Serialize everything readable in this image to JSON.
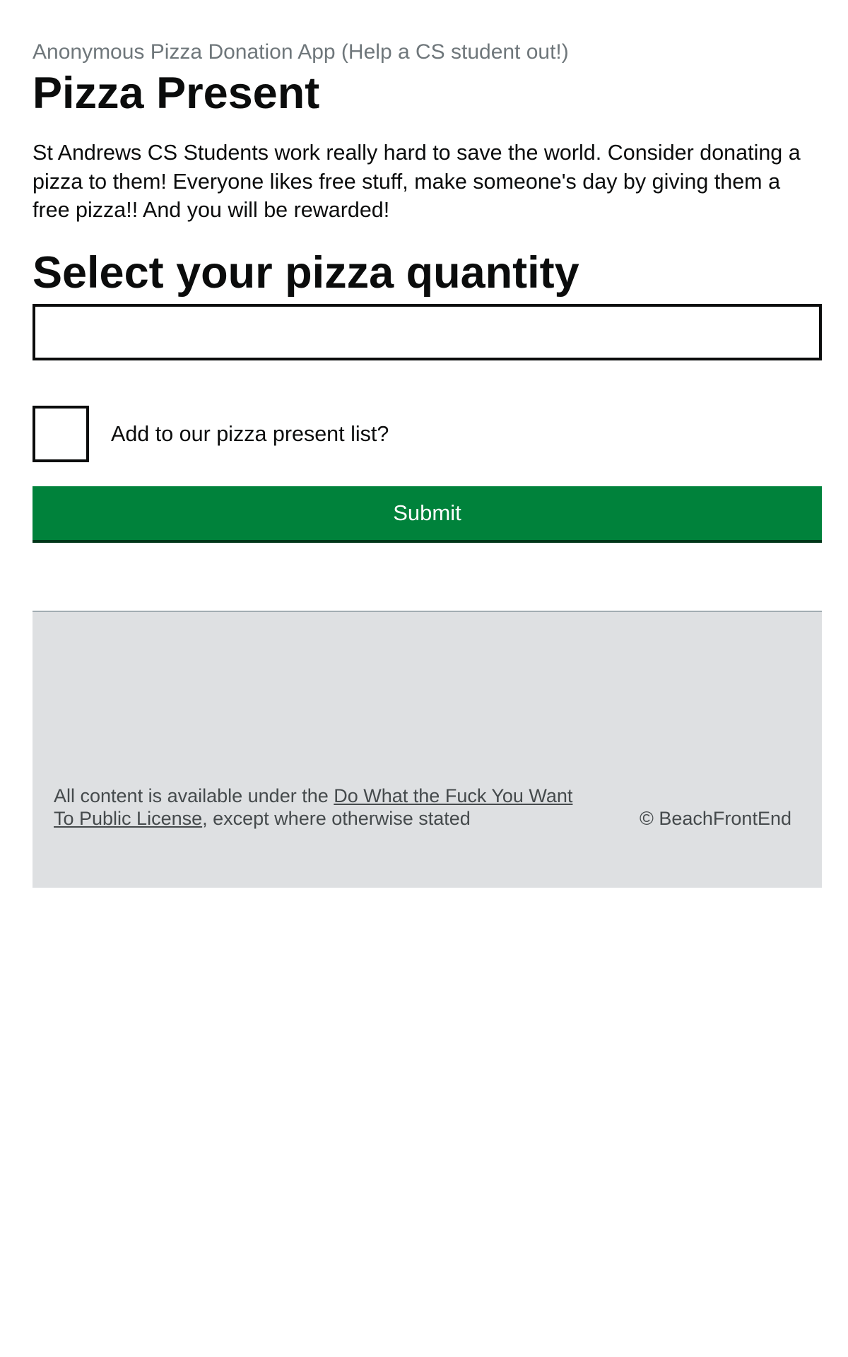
{
  "header": {
    "caption": "Anonymous Pizza Donation App (Help a CS student out!)",
    "title": "Pizza Present"
  },
  "main": {
    "description": "St Andrews CS Students work really hard to save the world. Consider donating a pizza to them! Everyone likes free stuff, make someone's day by giving them a free pizza!! And you will be rewarded!",
    "quantity_heading": "Select your pizza quantity",
    "quantity_input": {
      "value": "",
      "placeholder": ""
    },
    "checkbox": {
      "label": "Add to our pizza present list?",
      "checked": false
    },
    "submit_label": "Submit"
  },
  "footer": {
    "licence_prefix": "All content is available under the ",
    "licence_link": "Do What the Fuck You Want To Public License",
    "licence_suffix": ", except where otherwise stated",
    "copyright": "© BeachFrontEnd"
  },
  "colors": {
    "button_green": "#00823b",
    "footer_background": "#dee0e2",
    "caption_grey": "#6f777b",
    "text": "#0b0c0c"
  }
}
